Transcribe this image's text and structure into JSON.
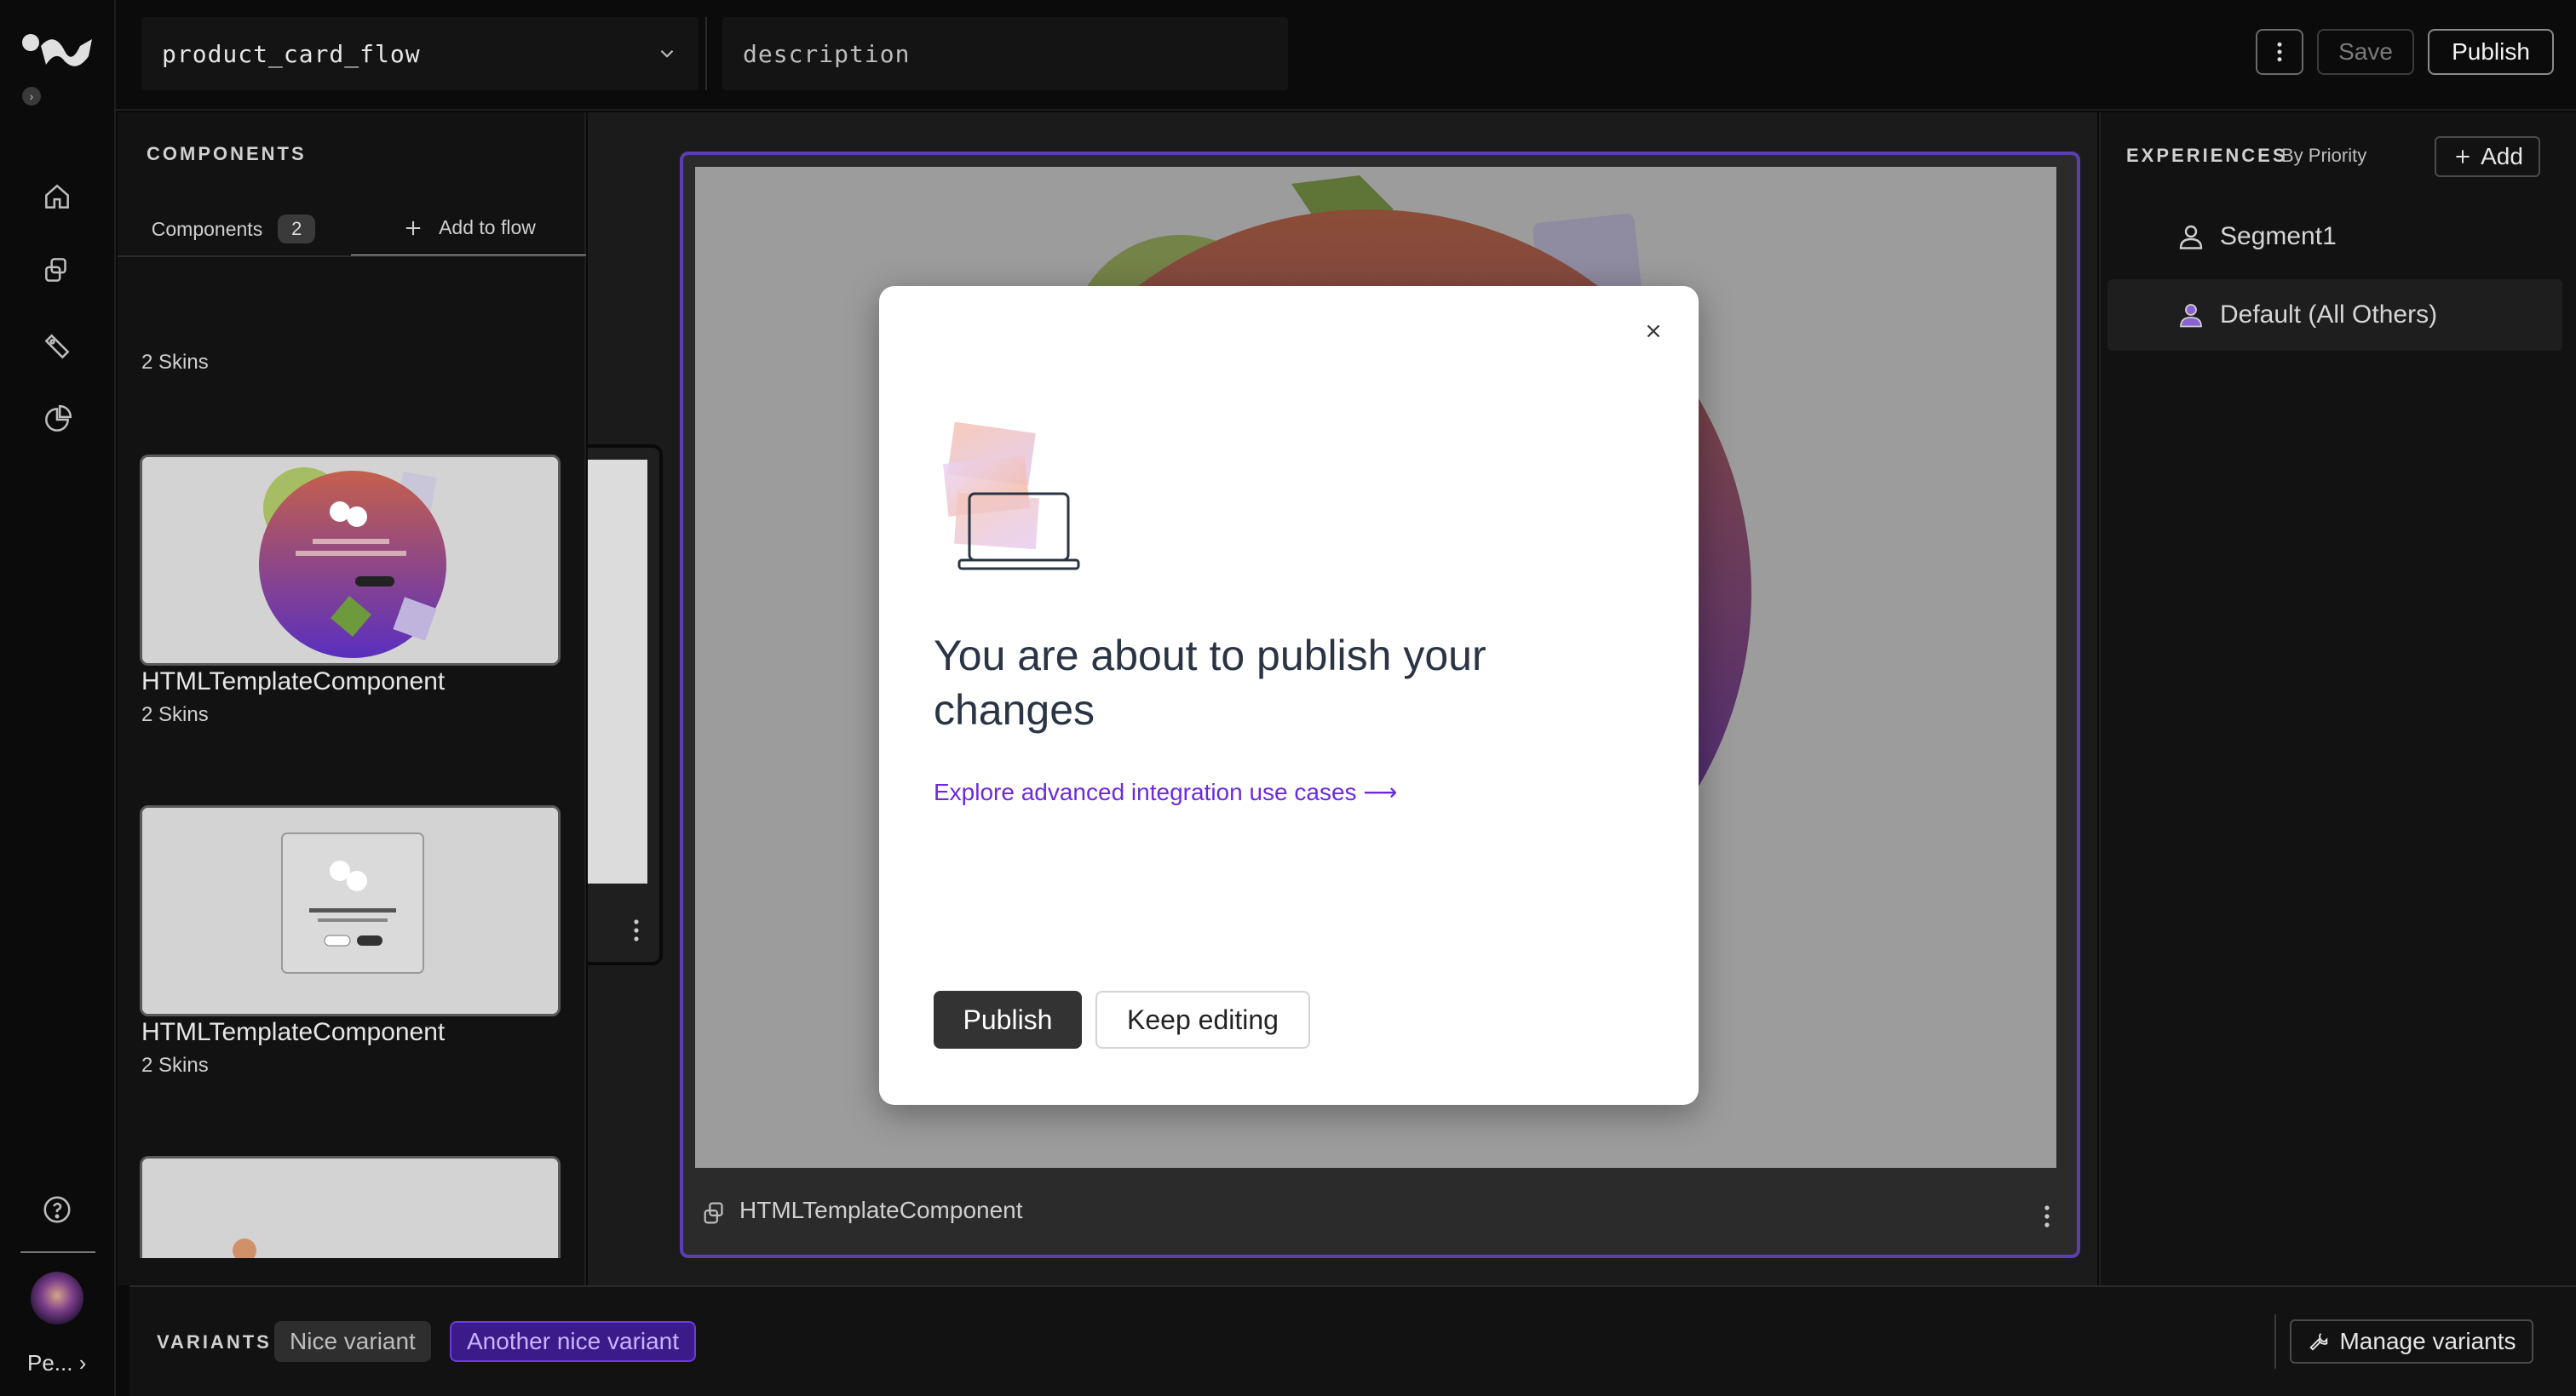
{
  "topbar": {
    "flow_name": "product_card_flow",
    "description_placeholder": "description",
    "save_label": "Save",
    "publish_label": "Publish"
  },
  "rail": {
    "icons": [
      "home-icon",
      "components-icon",
      "tag-icon",
      "analytics-icon",
      "help-icon"
    ],
    "user_label": "Pe..."
  },
  "components_panel": {
    "title": "COMPONENTS",
    "tab_components": "Components",
    "tab_components_count": "2",
    "tab_add": "Add to flow",
    "top_skins": "2 Skins",
    "cards": [
      {
        "title": "HTMLTemplateComponent",
        "skins": "2 Skins"
      },
      {
        "title": "HTMLTemplateComponent",
        "skins": "2 Skins"
      }
    ]
  },
  "preview": {
    "component_label": "HTMLTemplateComponent"
  },
  "modal": {
    "title": "You are about to publish your changes",
    "link": "Explore advanced integration use cases",
    "publish_label": "Publish",
    "keep_editing_label": "Keep editing"
  },
  "experiences": {
    "title": "EXPERIENCES",
    "sort_label": "By Priority",
    "add_label": "Add",
    "segments": [
      {
        "label": "Segment1"
      },
      {
        "label": "Default (All Others)"
      }
    ]
  },
  "variants": {
    "title": "VARIANTS",
    "chips": [
      {
        "label": "Nice variant"
      },
      {
        "label": "Another nice variant"
      }
    ],
    "manage_label": "Manage variants"
  },
  "colors": {
    "accent": "#6c2bd9",
    "frame_border": "#5b3fb0",
    "active_chip": "#3b1a8a"
  }
}
